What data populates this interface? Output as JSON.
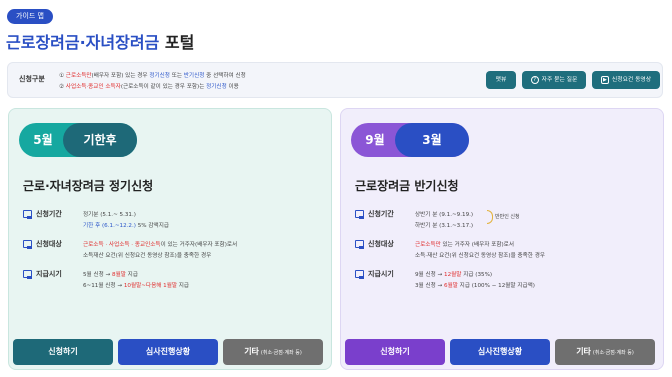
{
  "header": {
    "badge": "가이드 맵",
    "title_main": "근로장려금·자녀장려금",
    "title_suffix": " 포털"
  },
  "info": {
    "label": "신청구분",
    "line1": {
      "prefix": "① ",
      "a": "근로소득만",
      "b": "(배우자 포함) 있는 경우 ",
      "c": "정기신청",
      "d": " 또는 ",
      "e": "반기신청",
      "f": " 중 선택하여 신청"
    },
    "line2": {
      "prefix": "② ",
      "a": "사업소득·종교인 소득자",
      "b": "(근로소득이 같이 있는 경우 포함)는 ",
      "c": "정기신청",
      "d": " 이용"
    },
    "buttons": {
      "help": "맷뷰",
      "faq": "자주 묻는 질문",
      "video": "신청요건 동영상"
    }
  },
  "cards": [
    {
      "period_month": "5월",
      "period_label": "기한후",
      "title": "근로·자녀장려금 정기신청",
      "rows": [
        {
          "label": "신청기간",
          "line1": "정기분 (5.1.~ 5.31.)",
          "line2_a": "기한 후 (6.1.~12.2.)",
          "line2_b": "5% 감액지급"
        },
        {
          "label": "신청대상",
          "line1_a": "근로소득 · 사업소득 · 종교인소득",
          "line1_b": "이 있는 거주자(배우자 포함)로서",
          "line2": "소득재산 요건(위 신청요건 동영상 참조)을 충족한 경우"
        },
        {
          "label": "지급시기",
          "line1_a": "5월 신청 → ",
          "line1_b": "8월말",
          "line1_c": " 지급",
          "line2_a": "6~11월 신청 → ",
          "line2_b": "10월말~다음해 1월말",
          "line2_c": " 지급"
        }
      ],
      "actions": {
        "apply": "신청하기",
        "status": "심사진행상황",
        "etc": "기타",
        "etc_note": "(취소·금점·계좌 등)"
      }
    },
    {
      "period_month": "9월",
      "period_label": "3월",
      "title": "근로장려금 반기신청",
      "rows": [
        {
          "label": "신청기간",
          "line1": "상반기 분 (9.1.~9.19.)",
          "line2": "하반기 분 (3.1.~3.17.)",
          "half_note": "반반인 신청"
        },
        {
          "label": "신청대상",
          "line1_a": "근로소득만",
          "line1_b": " 있는 거주자 (배우자 포함)로서",
          "line2": "소득·재산 요건(위 신청요건 동영상 참조)을 충족한 경우"
        },
        {
          "label": "지급시기",
          "line1_a": "9월 신청 → ",
          "line1_b": "12월말",
          "line1_c": " 지급 (35%)",
          "line2_a": "3월 신청 → ",
          "line2_b": "6월말",
          "line2_c": " 지급 (100% − 12월말 지급액)"
        }
      ],
      "actions": {
        "apply": "신청하기",
        "status": "심사진행상황",
        "etc": "기타",
        "etc_note": "(취소·금점·계좌 등)"
      }
    }
  ],
  "colors": {
    "brand_blue": "#2a4fc4",
    "teal_dark": "#1e6978",
    "teal_light": "#16a8a0",
    "purple": "#8b56d6",
    "red_accent": "#e02b2b"
  }
}
